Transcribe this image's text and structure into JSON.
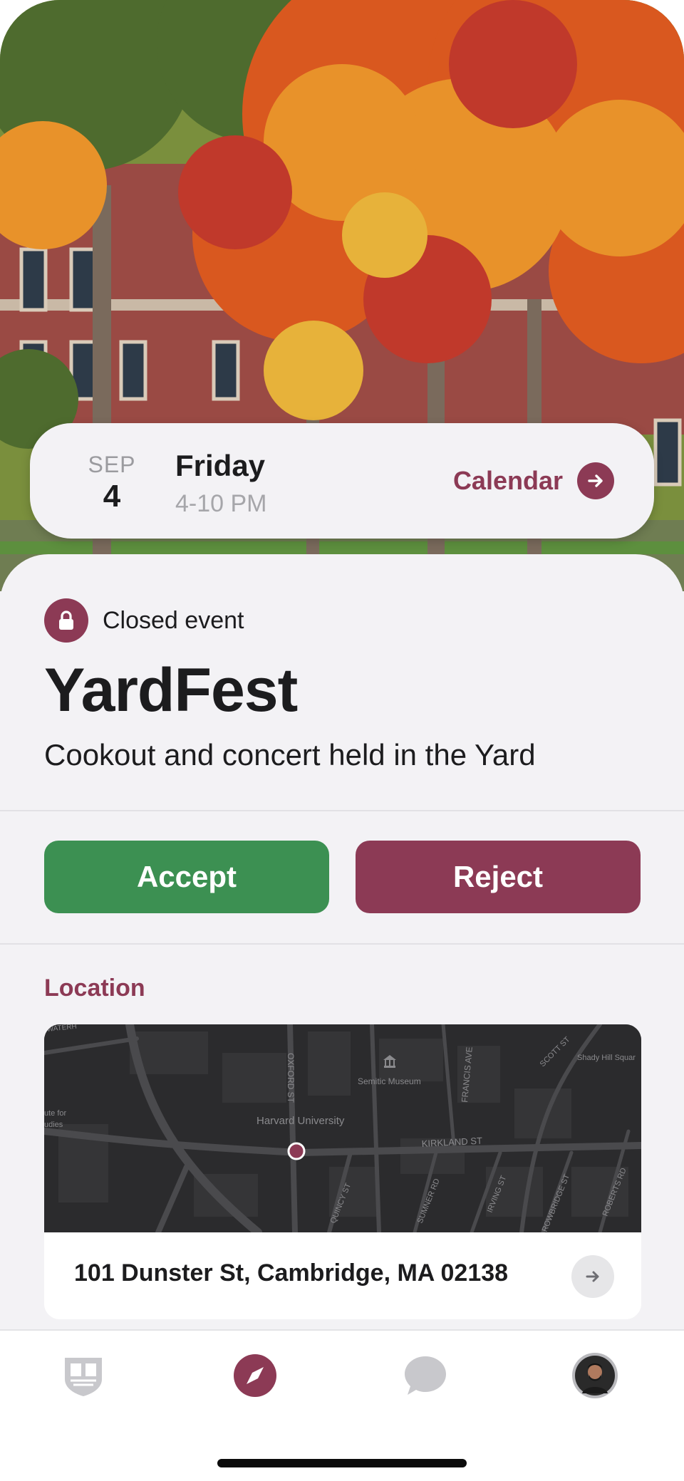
{
  "date_card": {
    "month": "SEP",
    "day": "4",
    "weekday": "Friday",
    "time": "4-10 PM",
    "calendar_label": "Calendar"
  },
  "event": {
    "badge": "Closed event",
    "title": "YardFest",
    "description": "Cookout and concert held in the Yard"
  },
  "actions": {
    "accept": "Accept",
    "reject": "Reject"
  },
  "location": {
    "heading": "Location",
    "address": "101 Dunster St, Cambridge, MA 02138",
    "map_labels": {
      "harvard": "Harvard University",
      "semitic": "Semitic Museum",
      "kirkland": "KIRKLAND ST",
      "oxford": "OXFORD ST",
      "francis": "FRANCIS AVE",
      "scott": "SCOTT ST",
      "shady": "Shady Hill Squar",
      "quincy": "QUINCY ST",
      "sumner": "SUMNER RD",
      "irving": "IRVING ST",
      "trowbridge": "ROWBRIDGE ST",
      "roberts": "ROBERTS RD",
      "waterhouse": "WATERH",
      "studies_1": "ute for",
      "studies_2": "udies"
    }
  },
  "tabbar": {
    "items": [
      "newspaper-icon",
      "compass-icon",
      "chat-bubble-icon",
      "profile-avatar"
    ],
    "active": "compass-icon"
  },
  "colors": {
    "accent": "#8c3a55",
    "accept": "#3c9052",
    "background": "#f3f2f5"
  }
}
